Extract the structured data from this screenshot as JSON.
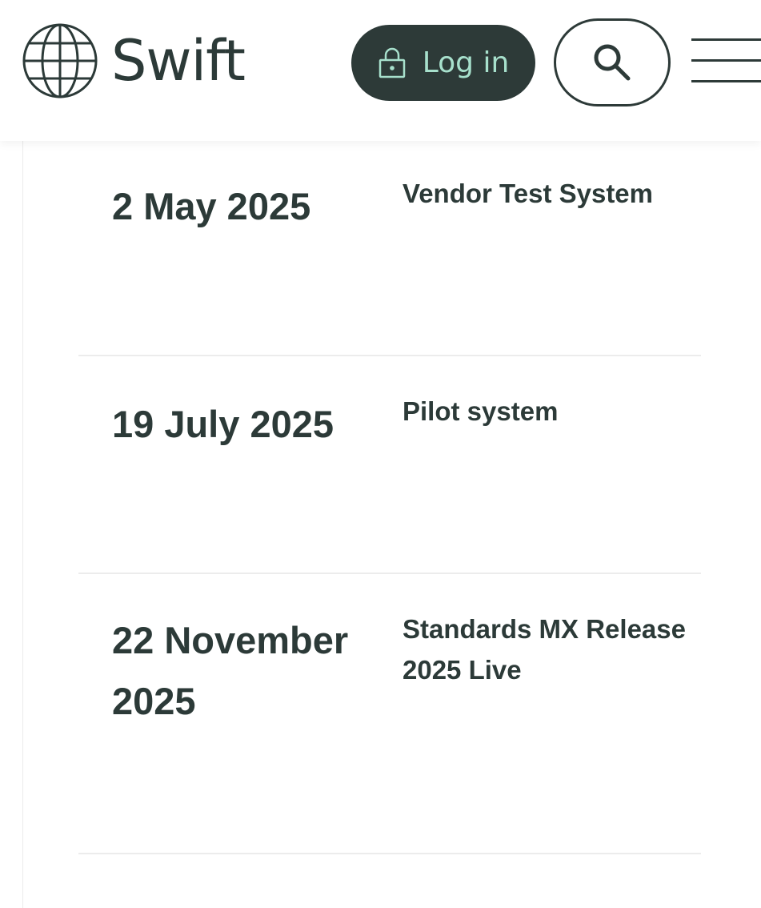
{
  "header": {
    "brand": "Swift",
    "login_label": "Log in",
    "icons": {
      "logo": "globe-icon",
      "login": "lock-icon",
      "search": "search-icon",
      "menu": "hamburger-menu-icon"
    },
    "colors": {
      "dark": "#2d3a38",
      "accent": "#a7e0cc"
    }
  },
  "timeline": [
    {
      "date": "2 May 2025",
      "event": "Vendor Test System"
    },
    {
      "date": "19 July 2025",
      "event": "Pilot system"
    },
    {
      "date": "22 November 2025",
      "event": "Standards MX Release 2025 Live"
    }
  ]
}
